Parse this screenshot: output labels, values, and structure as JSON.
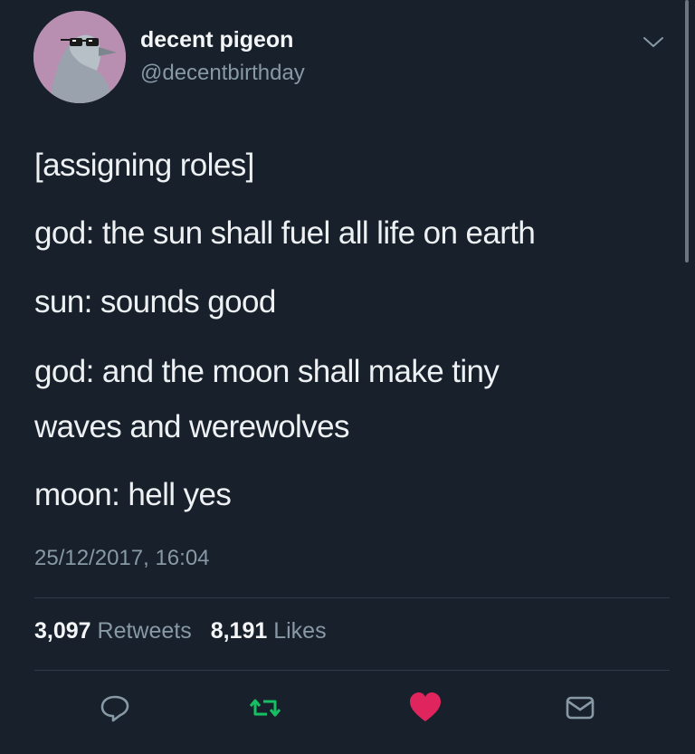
{
  "author": {
    "display_name": "decent pigeon",
    "handle": "@decentbirthday"
  },
  "tweet": {
    "lines": [
      "[assigning roles]",
      "god: the sun shall fuel all life on earth",
      "sun: sounds good",
      "god: and the moon shall make tiny",
      "waves and werewolves",
      "moon: hell yes"
    ],
    "timestamp": "25/12/2017, 16:04"
  },
  "stats": {
    "retweets_count": "3,097",
    "retweets_label": "Retweets",
    "likes_count": "8,191",
    "likes_label": "Likes"
  },
  "actions": {
    "reply_icon": "reply-icon",
    "retweet_icon": "retweet-icon",
    "like_icon": "heart-icon",
    "message_icon": "mail-icon"
  },
  "colors": {
    "background": "#17202b",
    "secondary_text": "#8899a6",
    "retweet_green": "#17bf63",
    "like_red": "#e0245e",
    "avatar_bg": "#b88fb1"
  }
}
